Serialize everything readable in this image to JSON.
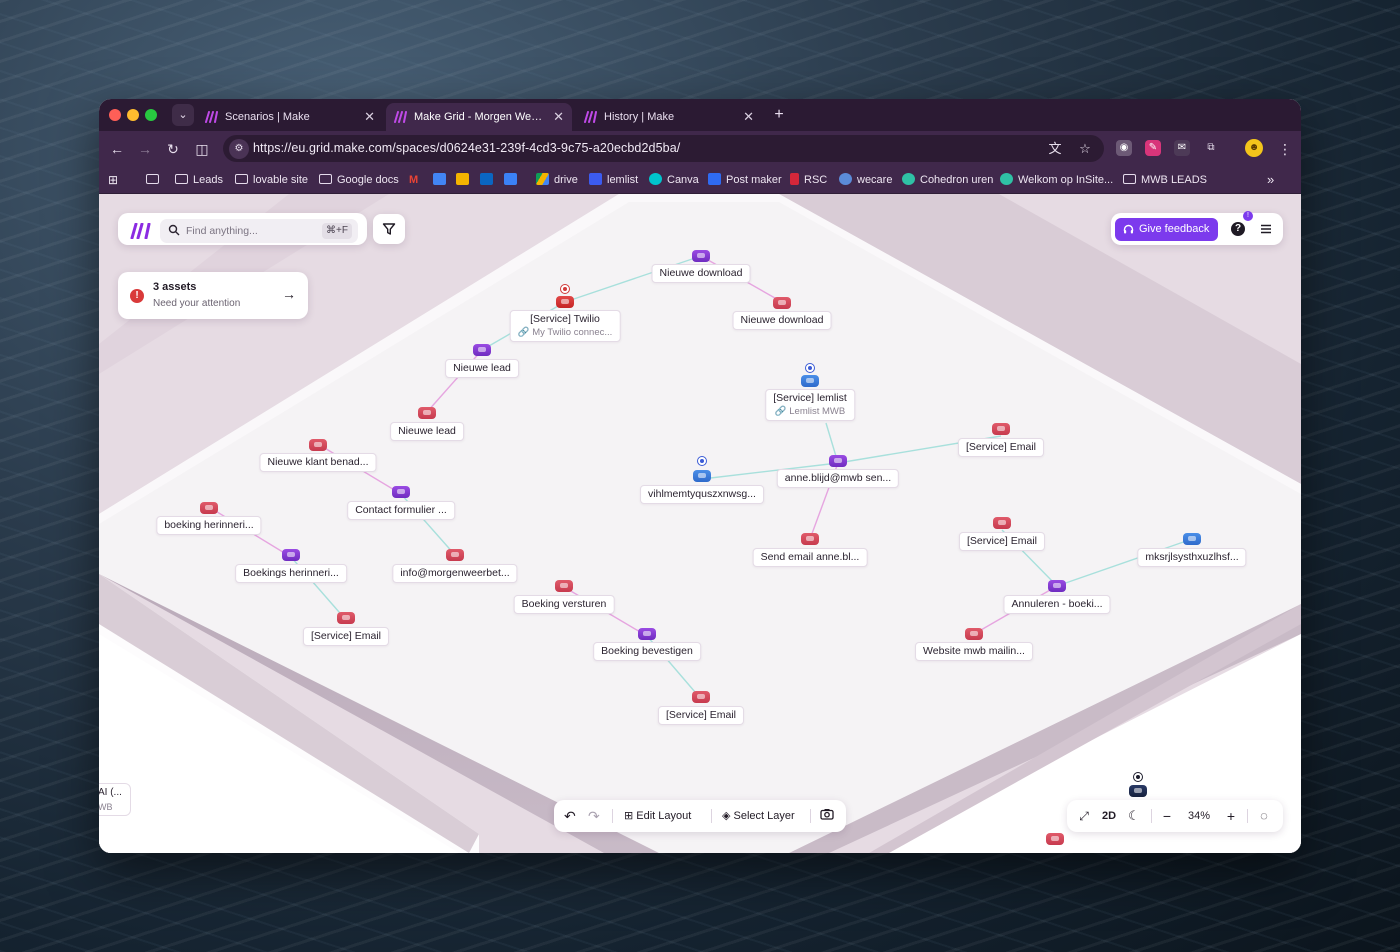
{
  "browser": {
    "tabs": [
      {
        "title": "Scenarios | Make",
        "active": false
      },
      {
        "title": "Make Grid - Morgen Weer Be",
        "active": true
      },
      {
        "title": "History | Make",
        "active": false
      }
    ],
    "url": "https://eu.grid.make.com/spaces/d0624e31-239f-4cd3-9c75-a20ecbd2d5ba/",
    "bookmarks": [
      "Leads",
      "lovable site",
      "Google docs",
      "drive",
      "lemlist",
      "Canva",
      "Post maker",
      "RSC",
      "wecare",
      "Cohedron uren",
      "Welkom op InSite...",
      "MWB LEADS"
    ]
  },
  "app": {
    "search_placeholder": "Find anything...",
    "search_shortcut": "⌘+F",
    "assets_title": "3 assets",
    "assets_subtitle": "Need your attention",
    "feedback_label": "Give feedback",
    "notification_count": "!",
    "help_label": "?"
  },
  "nodes": {
    "nieuwe_download_1": "Nieuwe download",
    "twilio_title": "[Service] Twilio",
    "twilio_sub": "My Twilio connec...",
    "nieuwe_download_2": "Nieuwe download",
    "nieuwe_lead_1": "Nieuwe lead",
    "nieuwe_lead_2": "Nieuwe lead",
    "lemlist_title": "[Service] lemlist",
    "lemlist_sub": "Lemlist MWB",
    "service_email_1": "[Service] Email",
    "anne": "anne.blijd@mwb sen...",
    "vihl": "vihlmemtyquszxnwsg...",
    "nieuwe_klant": "Nieuwe klant benad...",
    "contact": "Contact formulier ...",
    "boeking_herinneri": "boeking herinneri...",
    "bookings_herinneri": "Boekings herinneri...",
    "info": "info@morgenweerbet...",
    "service_email_2": "[Service] Email",
    "send_email": "Send email anne.bl...",
    "service_email_3": "[Service] Email",
    "mksr": "mksrjlsysthxuzlhsf...",
    "annuleren": "Annuleren - boeki...",
    "website": "Website mwb mailin...",
    "boeking_versturen": "Boeking versturen",
    "boeking_bevestigen": "Boeking bevestigen",
    "service_email_4": "[Service] Email",
    "partial_title": "AI (...",
    "partial_sub": "WB"
  },
  "bottom_toolbar": {
    "edit_layout": "Edit Layout",
    "select_layer": "Select Layer"
  },
  "zoom_toolbar": {
    "mode": "2D",
    "zoom": "34%"
  },
  "colors": {
    "accent": "#7c3aed",
    "tab_bar": "#2b1a33",
    "toolbar": "#40284b",
    "edge": "#9edbd8",
    "edge_pink": "#e29bdc"
  }
}
